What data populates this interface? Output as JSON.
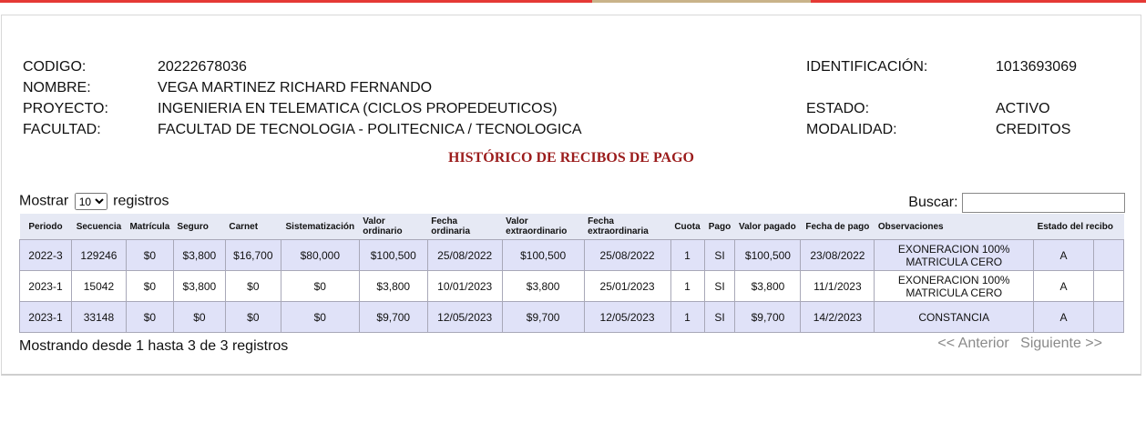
{
  "student": {
    "left": [
      {
        "label": "CODIGO:",
        "value": "20222678036"
      },
      {
        "label": "NOMBRE:",
        "value": "VEGA MARTINEZ RICHARD FERNANDO"
      },
      {
        "label": "PROYECTO:",
        "value": "INGENIERIA EN TELEMATICA (CICLOS PROPEDEUTICOS)"
      },
      {
        "label": "FACULTAD:",
        "value": "FACULTAD DE TECNOLOGIA - POLITECNICA / TECNOLOGICA"
      }
    ],
    "right": [
      {
        "label": "IDENTIFICACIÓN:",
        "value": "1013693069"
      },
      {
        "label": "",
        "value": ""
      },
      {
        "label": "ESTADO:",
        "value": "ACTIVO"
      },
      {
        "label": "MODALIDAD:",
        "value": "CREDITOS"
      }
    ]
  },
  "title": "HISTÓRICO DE RECIBOS DE PAGO",
  "controls": {
    "show_label": "Mostrar",
    "show_value": "10",
    "records_label": "registros",
    "search_label": "Buscar:",
    "search_value": ""
  },
  "table": {
    "headers": [
      "Periodo",
      "Secuencia",
      "Matrícula",
      "Seguro",
      "Carnet",
      "Sistematización",
      "Valor ordinario",
      "Fecha ordinaria",
      "Valor extraordinario",
      "Fecha extraordinaria",
      "Cuota",
      "Pago",
      "Valor pagado",
      "Fecha de pago",
      "Observaciones",
      "Estado del recibo"
    ],
    "rows": [
      [
        "2022-3",
        "129246",
        "$0",
        "$3,800",
        "$16,700",
        "$80,000",
        "$100,500",
        "25/08/2022",
        "$100,500",
        "25/08/2022",
        "1",
        "SI",
        "$100,500",
        "23/08/2022",
        "EXONERACION 100% MATRICULA CERO",
        "A"
      ],
      [
        "2023-1",
        "15042",
        "$0",
        "$3,800",
        "$0",
        "$0",
        "$3,800",
        "10/01/2023",
        "$3,800",
        "25/01/2023",
        "1",
        "SI",
        "$3,800",
        "11/1/2023",
        "EXONERACION 100% MATRICULA CERO",
        "A"
      ],
      [
        "2023-1",
        "33148",
        "$0",
        "$0",
        "$0",
        "$0",
        "$9,700",
        "12/05/2023",
        "$9,700",
        "12/05/2023",
        "1",
        "SI",
        "$9,700",
        "14/2/2023",
        "CONSTANCIA",
        "A"
      ]
    ]
  },
  "footer": {
    "summary": "Mostrando desde 1 hasta 3 de 3 registros",
    "prev": "<< Anterior",
    "next": "Siguiente >>"
  }
}
